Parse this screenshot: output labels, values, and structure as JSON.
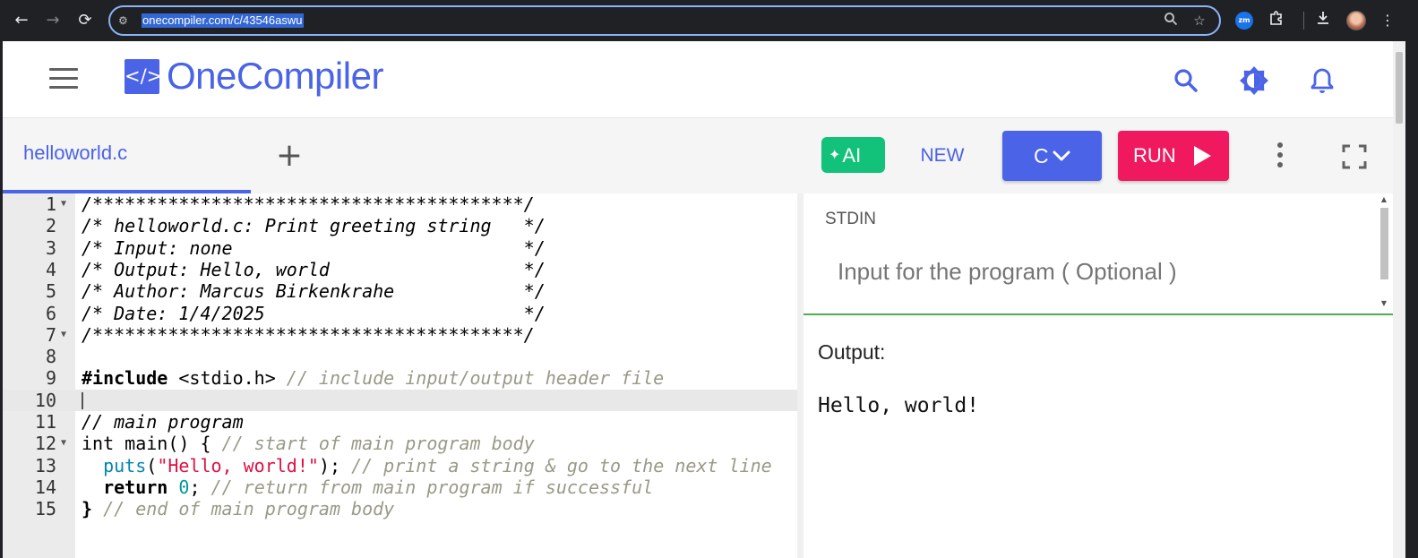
{
  "browser": {
    "url": "onecompiler.com/c/43546aswu",
    "zoom_ext_label": "zm"
  },
  "header": {
    "logo_icon": "</>",
    "logo_text": "OneCompiler"
  },
  "toolbar": {
    "file_tab": "helloworld.c",
    "add_tab": "+",
    "ai_label": "AI",
    "new_label": "NEW",
    "language": "C",
    "run_label": "RUN"
  },
  "editor": {
    "lines": [
      {
        "n": "1",
        "fold": true
      },
      {
        "n": "2"
      },
      {
        "n": "3"
      },
      {
        "n": "4"
      },
      {
        "n": "5"
      },
      {
        "n": "6"
      },
      {
        "n": "7",
        "fold": true
      },
      {
        "n": "8"
      },
      {
        "n": "9"
      },
      {
        "n": "10",
        "active": true
      },
      {
        "n": "11"
      },
      {
        "n": "12",
        "fold": true
      },
      {
        "n": "13"
      },
      {
        "n": "14"
      },
      {
        "n": "15"
      }
    ],
    "code": {
      "l1": "/****************************************/",
      "l2": "/* helloworld.c: Print greeting string   */",
      "l3": "/* Input: none                           */",
      "l4": "/* Output: Hello, world                  */",
      "l5": "/* Author: Marcus Birkenkrahe            */",
      "l6": "/* Date: 1/4/2025                        */",
      "l7": "/****************************************/",
      "l9_kw": "#include",
      "l9_hdr": " <stdio.h> ",
      "l9_cm": "// include input/output header file",
      "l11": "// main program",
      "l12_code": "int main() { ",
      "l12_cm": "// start of main program body",
      "l13_indent": "  ",
      "l13_fn": "puts",
      "l13_open": "(",
      "l13_str": "\"Hello, world!\"",
      "l13_close": "); ",
      "l13_cm": "// print a string & go to the next line",
      "l14_indent": "  ",
      "l14_kw": "return",
      "l14_sp": " ",
      "l14_num": "0",
      "l14_semi": "; ",
      "l14_cm": "// return from main program if successful",
      "l15_brace": "}",
      "l15_cm": " // end of main program body"
    }
  },
  "io": {
    "stdin_label": "STDIN",
    "stdin_placeholder": "Input for the program ( Optional )",
    "output_label": "Output:",
    "output_text": "Hello, world!"
  },
  "colors": {
    "brand": "#4a63e7",
    "ai": "#12c27a",
    "run": "#f0195f"
  }
}
